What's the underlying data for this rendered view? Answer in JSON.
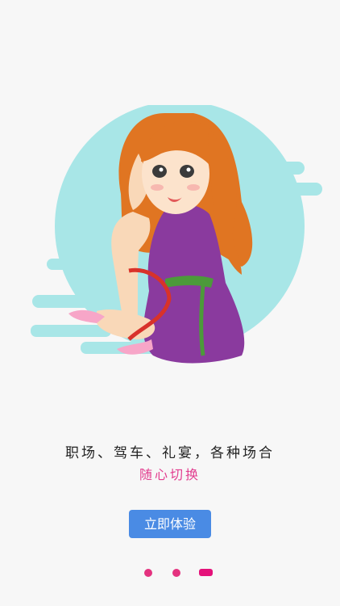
{
  "onboarding": {
    "headline": "职场、驾车、礼宴，各种场合",
    "subline": "随心切换",
    "cta_label": "立即体验"
  },
  "pager": {
    "total": 3,
    "active_index": 3
  },
  "colors": {
    "background": "#f7f7f7",
    "accent_pink": "#e23d8f",
    "button_blue": "#4a8be4",
    "circle_teal": "#a8e6e7"
  }
}
